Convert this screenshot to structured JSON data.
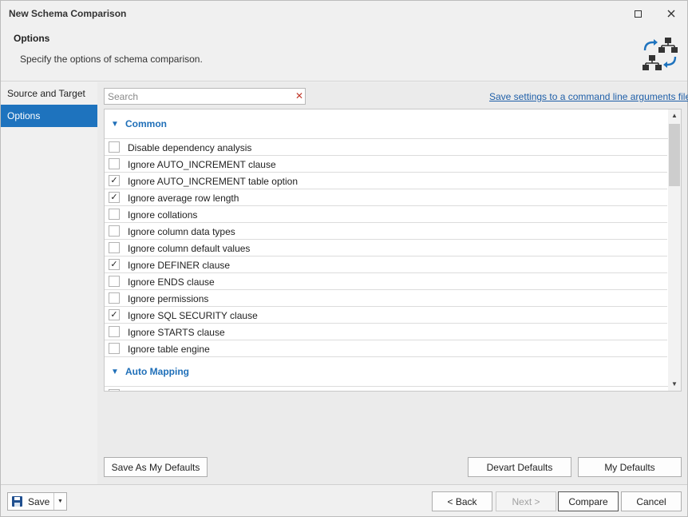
{
  "window": {
    "title": "New Schema Comparison"
  },
  "header": {
    "title": "Options",
    "subtitle": "Specify the options of schema comparison.",
    "icon": "schema-compare-icon"
  },
  "sidebar": {
    "items": [
      {
        "label": "Source and Target",
        "active": false
      },
      {
        "label": "Options",
        "active": true
      }
    ]
  },
  "search": {
    "placeholder": "Search",
    "value": ""
  },
  "save_settings_link": "Save settings to a command line arguments file...",
  "groups": [
    {
      "label": "Common",
      "expanded": true,
      "options": [
        {
          "label": "Disable dependency analysis",
          "checked": false
        },
        {
          "label": "Ignore AUTO_INCREMENT clause",
          "checked": false
        },
        {
          "label": "Ignore AUTO_INCREMENT table option",
          "checked": true
        },
        {
          "label": "Ignore average row length",
          "checked": true
        },
        {
          "label": "Ignore collations",
          "checked": false
        },
        {
          "label": "Ignore column data types",
          "checked": false
        },
        {
          "label": "Ignore column default values",
          "checked": false
        },
        {
          "label": "Ignore DEFINER clause",
          "checked": true
        },
        {
          "label": "Ignore ENDS clause",
          "checked": false
        },
        {
          "label": "Ignore permissions",
          "checked": false
        },
        {
          "label": "Ignore SQL SECURITY clause",
          "checked": true
        },
        {
          "label": "Ignore STARTS clause",
          "checked": false
        },
        {
          "label": "Ignore table engine",
          "checked": false
        }
      ]
    },
    {
      "label": "Auto Mapping",
      "expanded": true,
      "options": []
    }
  ],
  "buttons": {
    "save_as_defaults": "Save As My Defaults",
    "devart_defaults": "Devart Defaults",
    "my_defaults": "My Defaults",
    "save": "Save",
    "back": "< Back",
    "next": "Next >",
    "compare": "Compare",
    "cancel": "Cancel"
  },
  "colors": {
    "accent": "#1e73be",
    "group_header": "#1f6fb8",
    "link": "#1f5fa8"
  }
}
